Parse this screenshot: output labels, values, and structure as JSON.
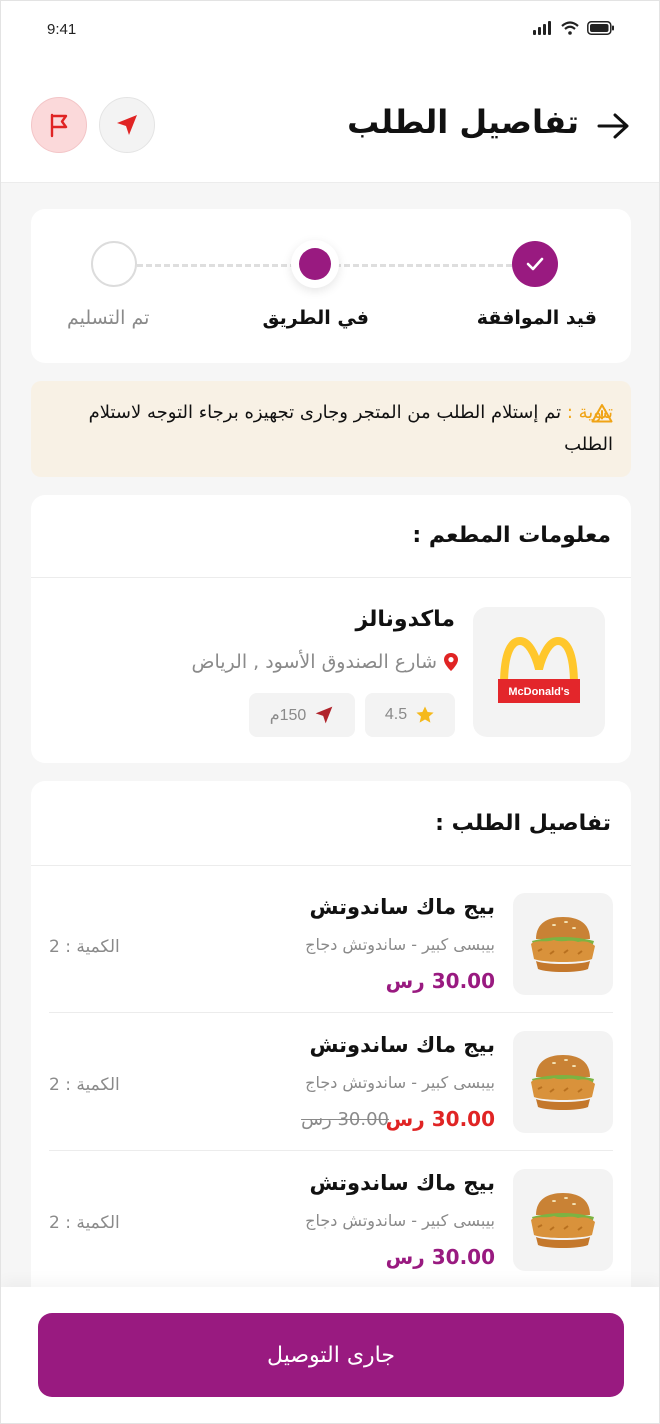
{
  "status_bar": {
    "time": "9:41"
  },
  "header": {
    "title": "تفاصيل الطلب"
  },
  "colors": {
    "primary": "#991a80",
    "danger": "#e02424",
    "warning": "#f0a416",
    "muted": "#8a8a8a",
    "star": "#f5b91b"
  },
  "stepper": {
    "steps": [
      {
        "label": "قيد الموافقة",
        "state": "completed"
      },
      {
        "label": "في الطريق",
        "state": "current"
      },
      {
        "label": "تم التسليم",
        "state": "pending"
      }
    ]
  },
  "notice": {
    "tag": "تنوية :",
    "text": "تم إستلام الطلب من المتجر وجارى تجهيزه برجاء التوجه لاستلام الطلب"
  },
  "restaurant": {
    "section_title": "معلومات المطعم :",
    "name": "ماكدونالز",
    "address": "شارع الصندوق الأسود , الرياض",
    "rating": "4.5",
    "distance": "150م",
    "logo_text": "McDonald's"
  },
  "order": {
    "section_title": "تفاصيل الطلب :",
    "items": [
      {
        "name": "بيج ماك ساندوتش",
        "desc": "بيبسى كبير - ساندوتش دجاج",
        "price": "30.00 رس",
        "old_price": "",
        "qty": "الكمية : 2",
        "price_color": "primary"
      },
      {
        "name": "بيج ماك ساندوتش",
        "desc": "بيبسى كبير - ساندوتش دجاج",
        "price": "30.00 رس",
        "old_price": "30.00 رس",
        "qty": "الكمية : 2",
        "price_color": "danger"
      },
      {
        "name": "بيج ماك ساندوتش",
        "desc": "بيبسى كبير - ساندوتش دجاج",
        "price": "30.00 رس",
        "old_price": "",
        "qty": "الكمية : 2",
        "price_color": "primary"
      }
    ]
  },
  "bottom": {
    "button_label": "جارى التوصيل"
  }
}
